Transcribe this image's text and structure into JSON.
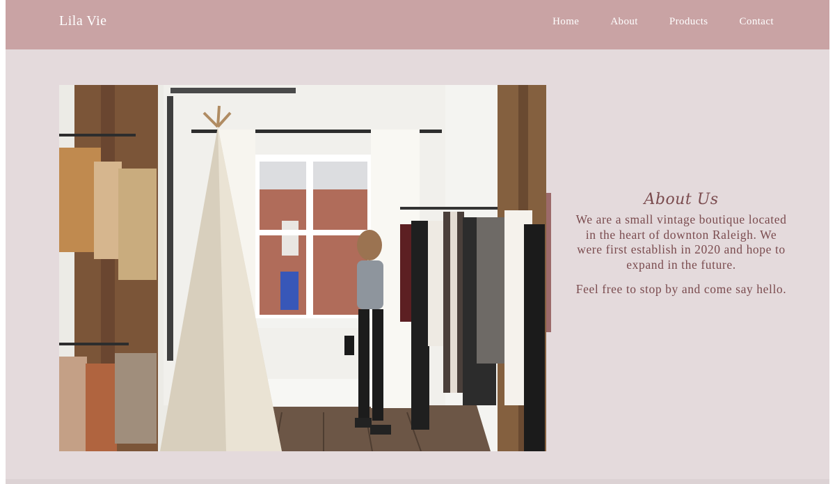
{
  "brand": {
    "name": "Lila Vie"
  },
  "nav": {
    "items": [
      {
        "label": "Home"
      },
      {
        "label": "About"
      },
      {
        "label": "Products"
      },
      {
        "label": "Contact"
      }
    ]
  },
  "hero": {
    "image_subject": "boutique-interior-photo"
  },
  "about": {
    "heading": "About Us",
    "paragraph1": "We are a small vintage boutique located in the heart of downton Raleigh. We were first establish in 2020 and hope to expand in the future.",
    "paragraph2": "Feel free to stop by and come say hello."
  },
  "colors": {
    "navbar": "#c9a3a4",
    "page_background": "#e4dadc",
    "accent": "#9c6a6a",
    "text": "#7a4b4e"
  }
}
